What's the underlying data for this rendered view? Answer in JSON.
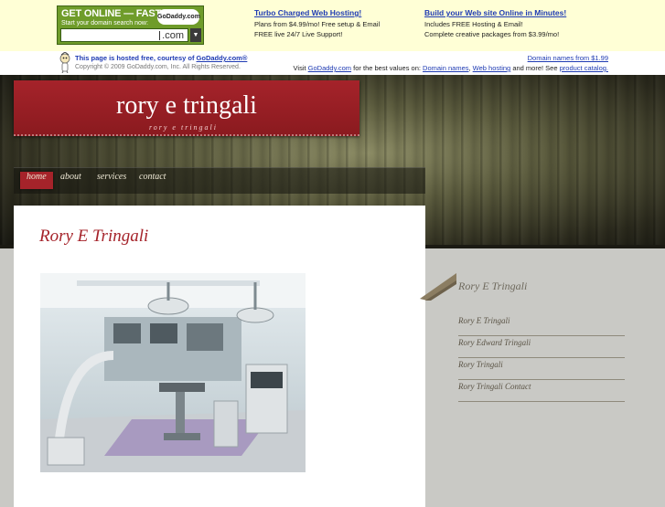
{
  "ad": {
    "box_headline": "GET ONLINE — FAST!",
    "box_sub": "Start your domain search now:",
    "box_logo": "GoDaddy.com",
    "tld": ".com",
    "col1": {
      "title": "Turbo Charged Web Hosting!",
      "line1": "Plans from $4.99/mo! Free setup & Email",
      "line2": "FREE live 24/7 Live Support!"
    },
    "col2": {
      "title": "Build your Web site Online in Minutes!",
      "line1": "Includes FREE Hosting & Email!",
      "line2": "Complete creative packages from $3.99/mo!"
    }
  },
  "hosted": {
    "text": "This page is hosted free, courtesy of",
    "link": "GoDaddy.com®",
    "copyright": "Copyright © 2009 GoDaddy.com, Inc. All Rights Reserved.",
    "domain_price": "Domain names from $1.99",
    "visit_pre": "Visit",
    "visit_link": "GoDaddy.com",
    "visit_mid": "for the best values on:",
    "domain_names": "Domain names",
    "web_hosting": "Web hosting",
    "visit_post": "and more! See",
    "product_catalog": "product catalog."
  },
  "site": {
    "title": "rory e tringali",
    "tagline": "rory e tringali"
  },
  "nav": {
    "home": "home",
    "about": "about",
    "services": "services",
    "contact": "contact"
  },
  "main": {
    "title": "Rory E Tringali"
  },
  "sidebar": {
    "title": "Rory E Tringali",
    "links": [
      "Rory E Tringali",
      "Rory Edward Tringali",
      "Rory Tringali",
      "Rory Tringali Contact"
    ]
  },
  "colors": {
    "accent_red": "#a5232a",
    "ad_background": "#ffffd6",
    "link_blue": "#1f3bb3"
  }
}
